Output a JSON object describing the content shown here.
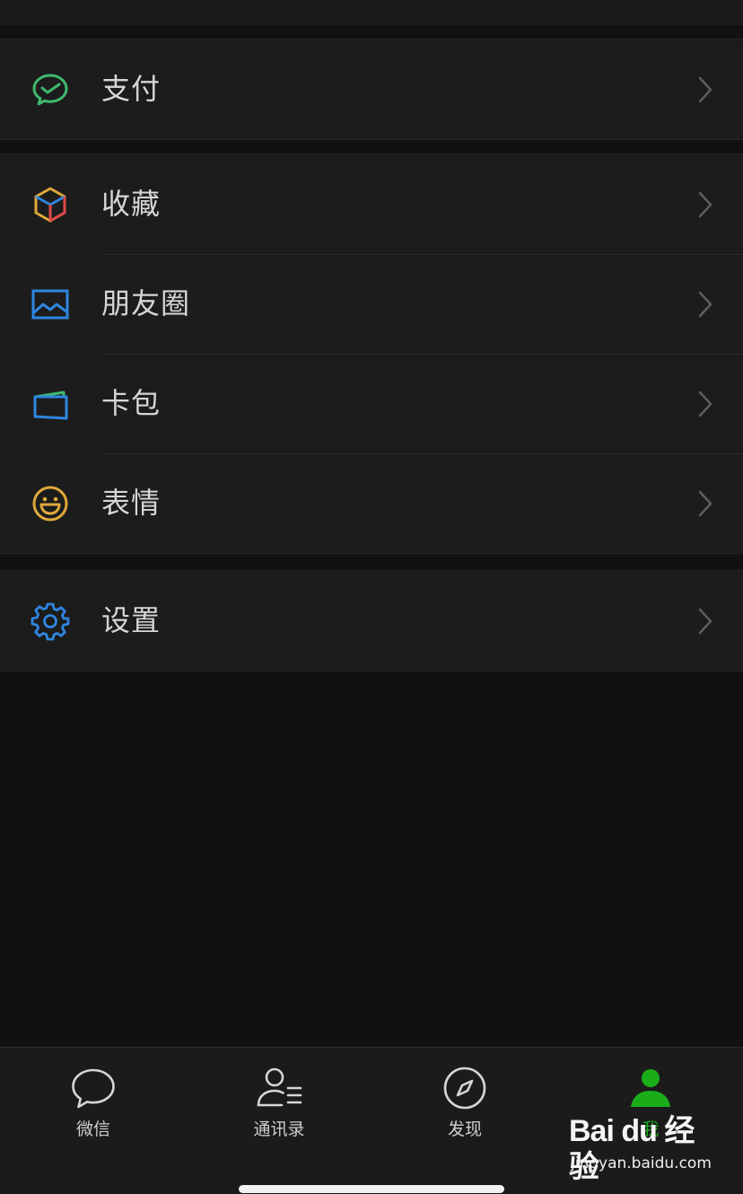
{
  "menu": {
    "groups": [
      {
        "items": [
          {
            "label": "支付",
            "icon": "pay-icon"
          }
        ]
      },
      {
        "items": [
          {
            "label": "收藏",
            "icon": "favorites-cube-icon"
          },
          {
            "label": "朋友圈",
            "icon": "moments-photo-icon"
          },
          {
            "label": "卡包",
            "icon": "card-wallet-icon"
          },
          {
            "label": "表情",
            "icon": "smiley-face-icon"
          }
        ]
      },
      {
        "items": [
          {
            "label": "设置",
            "icon": "gear-icon"
          }
        ]
      }
    ]
  },
  "tabbar": {
    "tabs": [
      {
        "label": "微信",
        "icon": "chat-bubble-icon"
      },
      {
        "label": "通讯录",
        "icon": "contacts-icon"
      },
      {
        "label": "发现",
        "icon": "compass-icon"
      },
      {
        "label": "我",
        "icon": "person-icon",
        "active": true
      }
    ]
  },
  "watermark": {
    "logo_text": "Bai du 经验",
    "url": "jingyan.baidu.com"
  },
  "colors": {
    "background": "#111111",
    "row_background": "#1c1c1c",
    "active_green": "#1aad19",
    "pay_green": "#3fb96d",
    "blue_icon": "#2f86e0",
    "yellow_icon": "#e0a93b"
  }
}
